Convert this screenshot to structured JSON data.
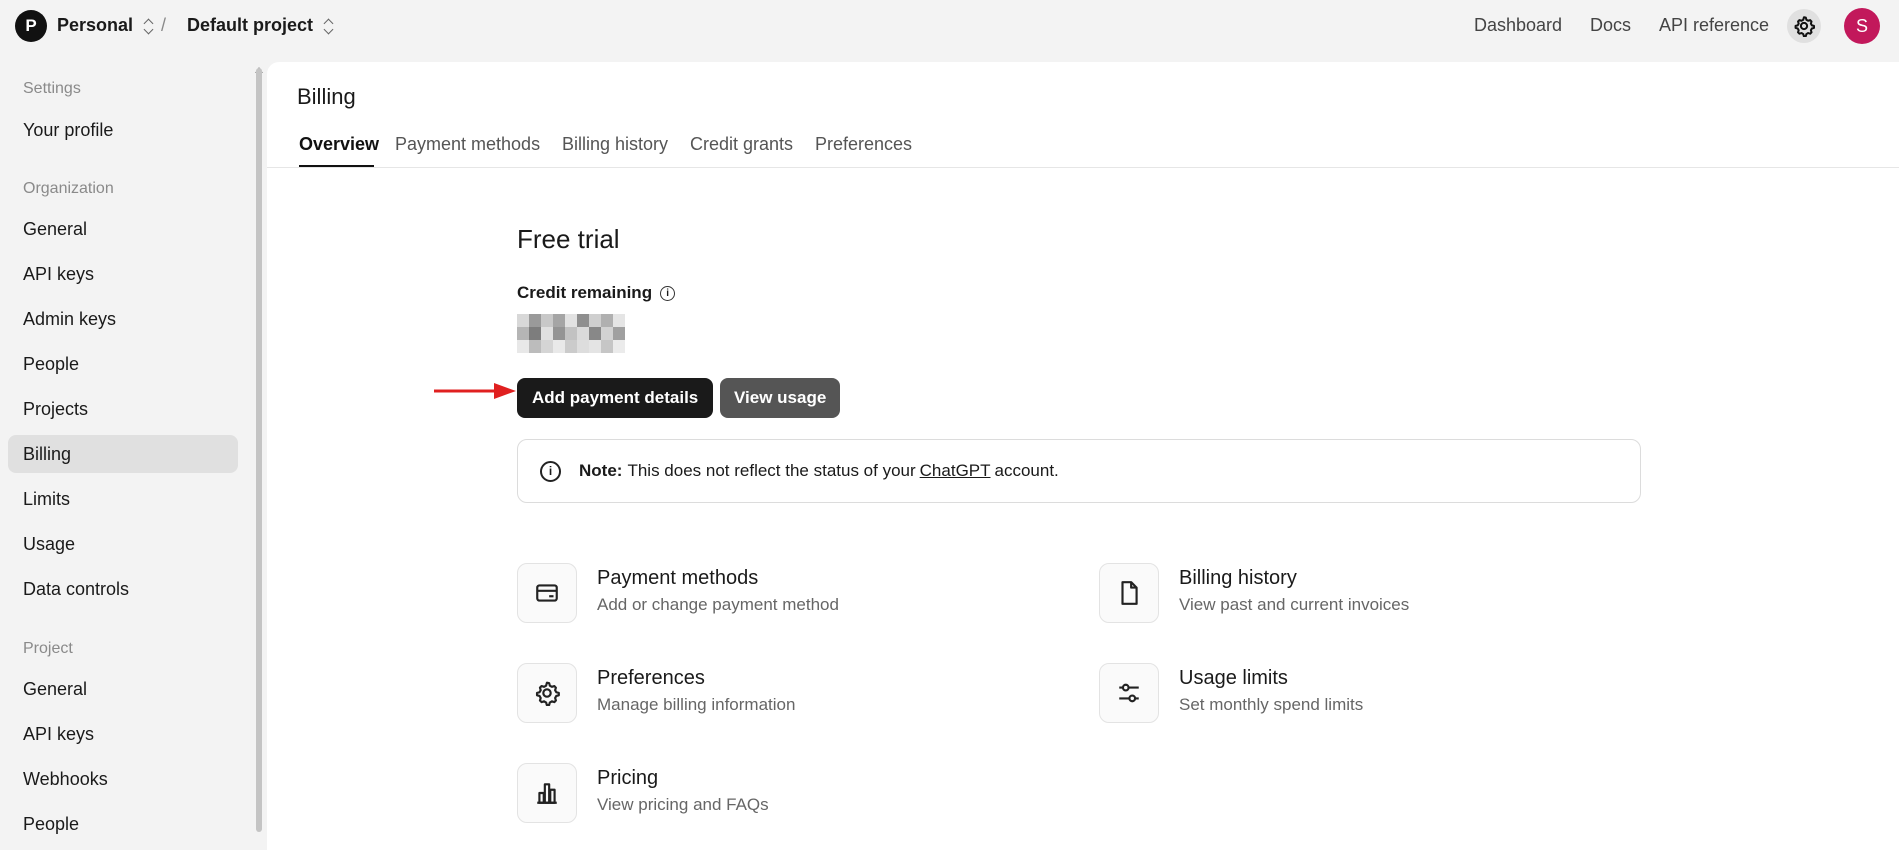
{
  "topbar": {
    "org_initial": "P",
    "org_name": "Personal",
    "separator": "/",
    "project_name": "Default project",
    "nav": [
      "Dashboard",
      "Docs",
      "API reference"
    ],
    "user_initial": "S",
    "user_avatar_color": "#c2185b"
  },
  "sidebar": {
    "settings_heading": "Settings",
    "your_profile": "Your profile",
    "organization_heading": "Organization",
    "org_items": [
      "General",
      "API keys",
      "Admin keys",
      "People",
      "Projects",
      "Billing",
      "Limits",
      "Usage",
      "Data controls"
    ],
    "active_item": "Billing",
    "project_heading": "Project",
    "project_items": [
      "General",
      "API keys",
      "Webhooks",
      "People"
    ]
  },
  "main": {
    "title": "Billing",
    "tabs": [
      "Overview",
      "Payment methods",
      "Billing history",
      "Credit grants",
      "Preferences"
    ],
    "active_tab": "Overview",
    "plan_title": "Free trial",
    "credit_label": "Credit remaining",
    "credit_value_redacted": true,
    "add_payment_label": "Add payment details",
    "view_usage_label": "View usage",
    "note": {
      "prefix": "Note:",
      "text_before": "This does not reflect the status of your",
      "link": "ChatGPT",
      "text_after": "account."
    },
    "cards": [
      {
        "icon": "credit-card-icon",
        "title": "Payment methods",
        "subtitle": "Add or change payment method"
      },
      {
        "icon": "document-icon",
        "title": "Billing history",
        "subtitle": "View past and current invoices"
      },
      {
        "icon": "gear-icon",
        "title": "Preferences",
        "subtitle": "Manage billing information"
      },
      {
        "icon": "sliders-icon",
        "title": "Usage limits",
        "subtitle": "Set monthly spend limits"
      },
      {
        "icon": "bar-chart-icon",
        "title": "Pricing",
        "subtitle": "View pricing and FAQs"
      }
    ]
  },
  "colors": {
    "accent_dark": "#1a1a1a",
    "secondary_button": "#555555",
    "annotation_arrow": "#e02020"
  }
}
